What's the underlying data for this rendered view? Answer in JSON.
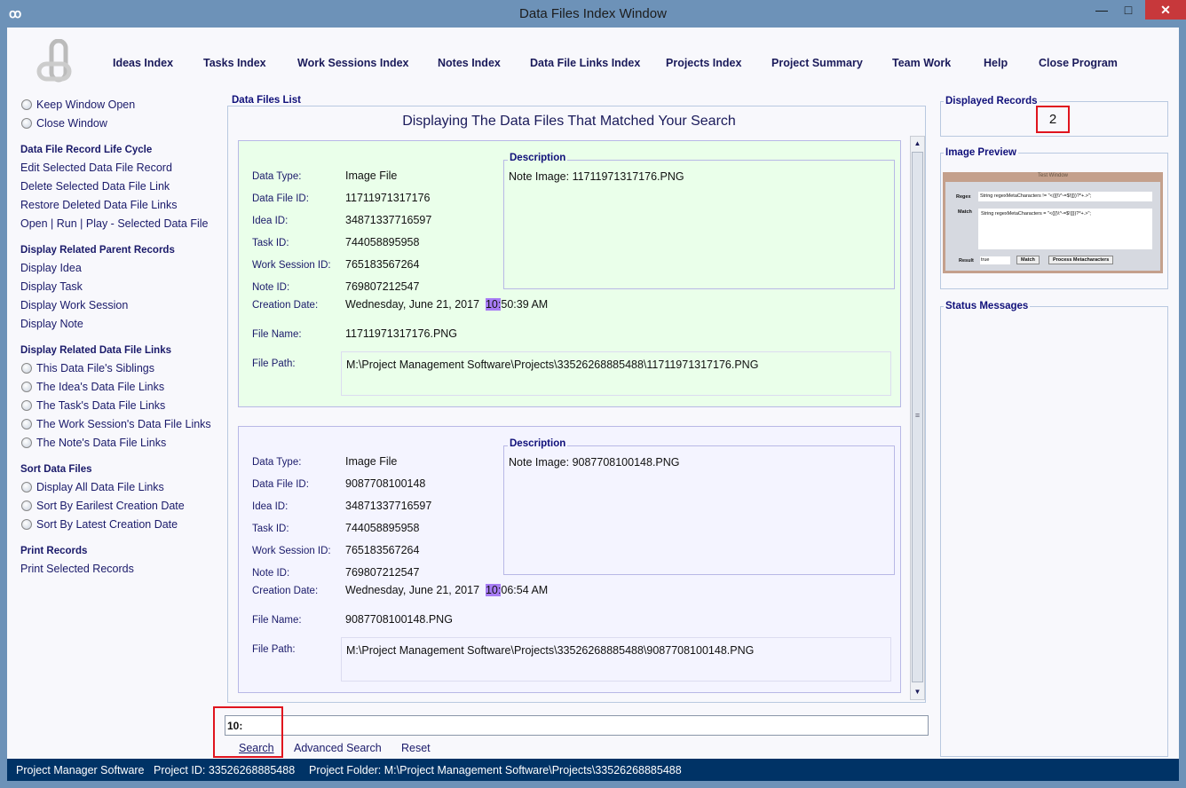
{
  "window": {
    "title": "Data Files Index Window",
    "min": "—",
    "max": "□",
    "close": "✕"
  },
  "nav": [
    "Ideas Index",
    "Tasks Index",
    "Work Sessions Index",
    "Notes Index",
    "Data File Links Index",
    "Projects Index",
    "Project Summary",
    "Team Work",
    "Help",
    "Close Program"
  ],
  "sidebar": {
    "window_options": [
      "Keep Window Open",
      "Close Window"
    ],
    "lifecycle_heading": "Data File Record Life Cycle",
    "lifecycle": [
      "Edit Selected Data File Record",
      "Delete Selected Data File Link",
      "Restore Deleted Data File Links",
      "Open | Run | Play - Selected Data File"
    ],
    "parents_heading": "Display Related Parent Records",
    "parents": [
      "Display Idea",
      "Display Task",
      "Display Work Session",
      "Display Note"
    ],
    "links_heading": "Display Related Data File Links",
    "links": [
      "This Data File's Siblings",
      "The Idea's Data File Links",
      "The Task's Data File Links",
      "The Work Session's Data File Links",
      "The Note's Data File Links"
    ],
    "sort_heading": "Sort Data Files",
    "sort": [
      "Display All Data File Links",
      "Sort By Earilest Creation Date",
      "Sort By Latest Creation Date"
    ],
    "print_heading": "Print Records",
    "print": [
      "Print Selected Records"
    ]
  },
  "list": {
    "group_label": "Data Files List",
    "heading": "Displaying The Data Files That Matched Your Search",
    "labels": {
      "type": "Data Type:",
      "file_id": "Data File ID:",
      "idea_id": "Idea ID:",
      "task_id": "Task ID:",
      "session_id": "Work Session ID:",
      "note_id": "Note ID:",
      "date": "Creation Date:",
      "name": "File Name:",
      "path": "File Path:",
      "description": "Description"
    },
    "records": [
      {
        "type": "Image File",
        "file_id": "11711971317176",
        "idea_id": "34871337716597",
        "task_id": "744058895958",
        "session_id": "765183567264",
        "note_id": "769807212547",
        "date_prefix": "Wednesday, June 21, 2017  ",
        "date_match": "10:",
        "date_suffix": "50:39 AM",
        "name": "11711971317176.PNG",
        "path": "M:\\Project Management Software\\Projects\\33526268885488\\11711971317176.PNG",
        "description": "Note Image: 11711971317176.PNG",
        "bg": "#eaffea"
      },
      {
        "type": "Image File",
        "file_id": "9087708100148",
        "idea_id": "34871337716597",
        "task_id": "744058895958",
        "session_id": "765183567264",
        "note_id": "769807212547",
        "date_prefix": "Wednesday, June 21, 2017  ",
        "date_match": "10:",
        "date_suffix": "06:54 AM",
        "name": "9087708100148.PNG",
        "path": "M:\\Project Management Software\\Projects\\33526268885488\\9087708100148.PNG",
        "description": "Note Image: 9087708100148.PNG",
        "bg": "#f4f4ff"
      }
    ]
  },
  "search": {
    "value": "10:",
    "search": "Search",
    "advanced": "Advanced Search",
    "reset": "Reset"
  },
  "right": {
    "displayed_label": "Displayed Records",
    "displayed_count": "2",
    "preview_label": "Image Preview",
    "status_label": "Status Messages",
    "preview": {
      "title": "Test Window",
      "regex_label": "Regex",
      "regex_value": "String regexMetaCharacters != \"<([{\\\\^-=$!|]})?*+.>\";",
      "match_label": "Match",
      "match_value": "String regexMetaCharacters = \"<([{\\\\^-=$!|]})?*+.>\";",
      "result_label": "Result",
      "result_value": "true",
      "match_btn": "Match",
      "process_btn": "Process Metacharacters"
    }
  },
  "statusbar": {
    "app": "Project Manager Software",
    "project_id": "Project ID:  33526268885488",
    "folder": "Project Folder: M:\\Project Management Software\\Projects\\33526268885488"
  }
}
